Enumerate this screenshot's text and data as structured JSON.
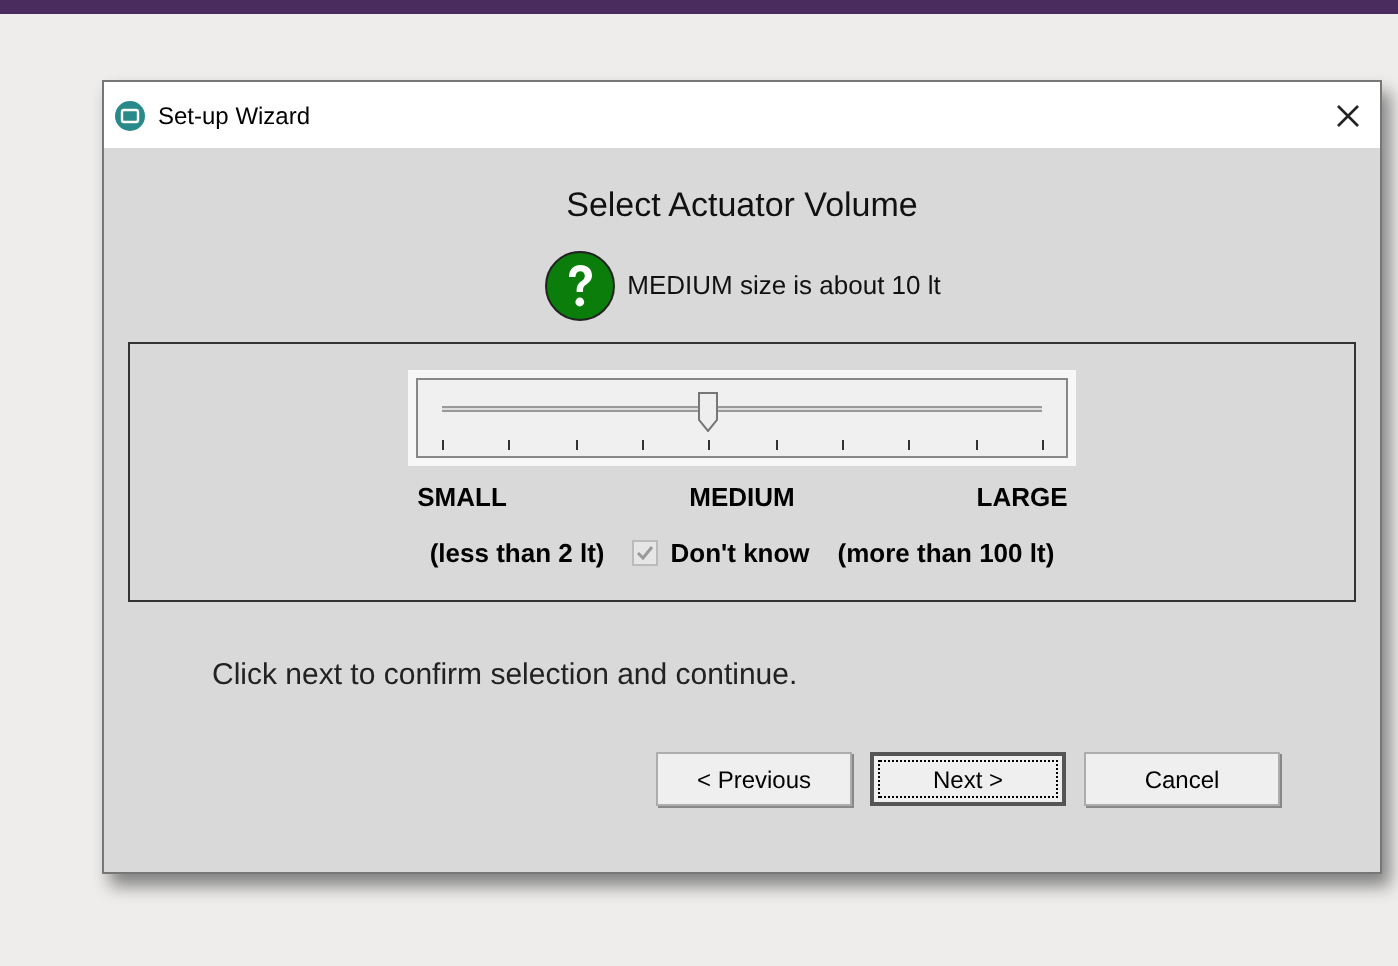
{
  "window": {
    "title": "Set-up Wizard"
  },
  "heading": "Select Actuator Volume",
  "hint": "MEDIUM size is about 10 lt",
  "slider": {
    "level": 0.444
  },
  "scale_labels": [
    {
      "label": "SMALL",
      "note": "(less than 2 lt)"
    },
    {
      "label": "MEDIUM"
    },
    {
      "label": "LARGE",
      "note": "(more than 100 lt)"
    }
  ],
  "dont_know": {
    "label": "Don't know",
    "checked": true,
    "disabled": true
  },
  "instruction": "Click next to confirm selection and continue.",
  "buttons": [
    {
      "label": "< Previous",
      "default": false
    },
    {
      "label": "Next >",
      "default": true
    },
    {
      "label": "Cancel",
      "default": false
    }
  ]
}
